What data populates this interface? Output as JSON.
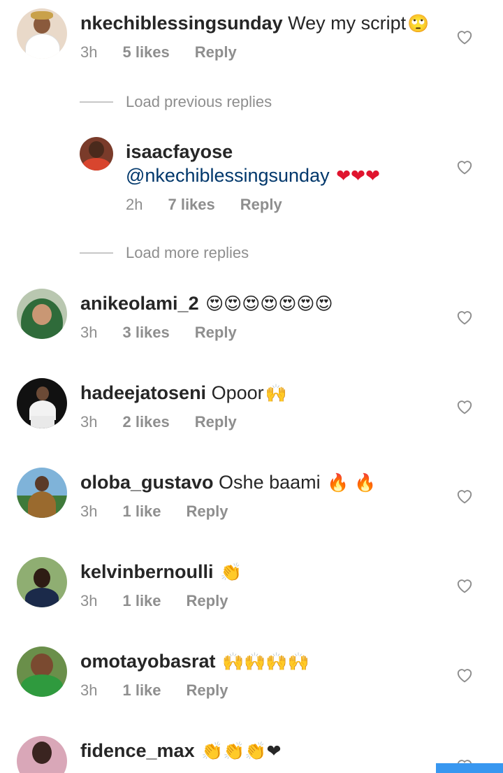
{
  "comments": [
    {
      "id": "c1",
      "username": "nkechiblessingsunday",
      "text": "Wey my script",
      "emoji": "🙄",
      "time": "3h",
      "likes": "5 likes",
      "reply": "Reply"
    },
    {
      "id": "c2",
      "username": "isaacfayose",
      "mention": "@nkechiblessingsunday",
      "emoji": "❤❤❤",
      "time": "2h",
      "likes": "7 likes",
      "reply": "Reply"
    },
    {
      "id": "c3",
      "username": "anikeolami_2",
      "text": "",
      "emoji": "😍😍😍😍😍😍😍",
      "time": "3h",
      "likes": "3 likes",
      "reply": "Reply"
    },
    {
      "id": "c4",
      "username": "hadeejatoseni",
      "text": "Opoor",
      "emoji": "🙌",
      "time": "3h",
      "likes": "2 likes",
      "reply": "Reply"
    },
    {
      "id": "c5",
      "username": "oloba_gustavo",
      "text": "Oshe baami",
      "emoji": "🔥 🔥",
      "time": "3h",
      "likes": "1 like",
      "reply": "Reply"
    },
    {
      "id": "c6",
      "username": "kelvinbernoulli",
      "text": "",
      "emoji": "👏",
      "time": "3h",
      "likes": "1 like",
      "reply": "Reply"
    },
    {
      "id": "c7",
      "username": "omotayobasrat",
      "text": "",
      "emoji": "🙌🙌🙌🙌",
      "time": "3h",
      "likes": "1 like",
      "reply": "Reply"
    },
    {
      "id": "c8",
      "username": "fidence_max",
      "text": "",
      "emoji": "👏👏👏❤"
    }
  ],
  "load_previous": "Load previous replies",
  "load_more": "Load more replies",
  "icons": {
    "like": "heart-outline-icon"
  },
  "colors": {
    "meta": "#8e8e8e",
    "mention": "#00376b",
    "accent": "#3897f0"
  }
}
